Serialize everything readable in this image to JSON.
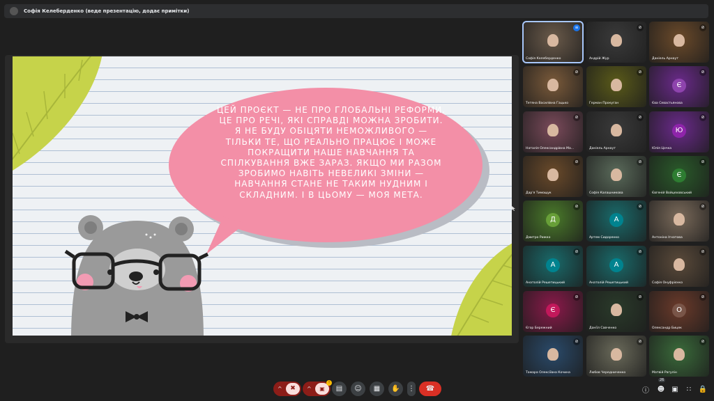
{
  "topbar": {
    "title": "Софія Келеберденко (веде презентацію, додає примітки)"
  },
  "slide": {
    "text": "Цей проєкт — не про глобальні реформи. Це про речі, які справді можна зробити. Я не буду обіцяти неможливого — тільки те, що реально працює і може покращити наше навчання та спілкування вже зараз. Якщо ми разом зробимо навіть невеликі зміни — навчання стане не таким нудним і складним. І в цьому — моя мета.",
    "colors": {
      "bubble": "#f38fa7",
      "leaf": "#c6d34a",
      "bear": "#9a9a9a"
    }
  },
  "participants": [
    {
      "name": "Софія Келеберденко",
      "type": "video",
      "bg": "#6a5a4a",
      "mic_icon": "speaking-icon",
      "active": true
    },
    {
      "name": "Андрій Жур",
      "type": "video",
      "bg": "#3a3a3a",
      "mic_icon": "mic-off-icon"
    },
    {
      "name": "Даніель Арнаут",
      "type": "video",
      "bg": "#6b4a2a",
      "mic_icon": "mic-off-icon"
    },
    {
      "name": "Тетяна Василівна Гацько",
      "type": "video",
      "bg": "#7a5a3a",
      "mic_icon": "mic-off-icon"
    },
    {
      "name": "Герман Прокуган",
      "type": "video",
      "bg": "#5a5a1a",
      "mic_icon": "mic-off-icon"
    },
    {
      "name": "Єва Севастьянова",
      "type": "letter",
      "letter": "Є",
      "bg": "#6a2a8a",
      "circle": "#8e44ad",
      "mic_icon": "mic-off-icon"
    },
    {
      "name": "Наталія Олександрівна Ма...",
      "type": "video",
      "bg": "#7a4a5a",
      "mic_icon": "mic-off-icon"
    },
    {
      "name": "Даніель Арнаут",
      "type": "video",
      "bg": "#3a3a3a",
      "mic_icon": "mic-off-icon"
    },
    {
      "name": "Юлія Цочка",
      "type": "letter",
      "letter": "Ю",
      "bg": "#6a2a8a",
      "circle": "#8e24aa",
      "mic_icon": "mic-off-icon"
    },
    {
      "name": "Дар'я Тимощук",
      "type": "video",
      "bg": "#6a4a2a",
      "mic_icon": "mic-off-icon"
    },
    {
      "name": "Софія Калашникова",
      "type": "video",
      "bg": "#5a6a5a",
      "mic_icon": "mic-off-icon"
    },
    {
      "name": "Євгеній Войцеховський",
      "type": "letter",
      "letter": "Є",
      "bg": "#2a5a2a",
      "circle": "#2e7d32",
      "mic_icon": "mic-off-icon"
    },
    {
      "name": "Дмитро Рижко",
      "type": "letter",
      "letter": "Д",
      "bg": "#4a7a2a",
      "circle": "#689f38",
      "mic_icon": "mic-off-icon"
    },
    {
      "name": "Артем Сидоренко",
      "type": "letter",
      "letter": "А",
      "bg": "#1a6a6a",
      "circle": "#00838f",
      "mic_icon": "mic-off-icon"
    },
    {
      "name": "Антоніна Ігнатова",
      "type": "video",
      "bg": "#7a6a5a",
      "mic_icon": "mic-off-icon"
    },
    {
      "name": "Анатолій Решетицький",
      "type": "letter",
      "letter": "А",
      "bg": "#1a6a6a",
      "circle": "#00838f",
      "mic_icon": "mic-off-icon"
    },
    {
      "name": "Анатолій Решетицький",
      "type": "letter",
      "letter": "А",
      "bg": "#1a6a6a",
      "circle": "#00838f",
      "mic_icon": "mic-off-icon"
    },
    {
      "name": "Софія Онуфрієнко",
      "type": "video",
      "bg": "#5a4a3a",
      "mic_icon": "mic-off-icon"
    },
    {
      "name": "Єгор Бережний",
      "type": "letter",
      "letter": "Є",
      "bg": "#8a1a4a",
      "circle": "#c2185b",
      "mic_icon": "mic-off-icon"
    },
    {
      "name": "Даніїл Савченко",
      "type": "video",
      "bg": "#2a3a2a",
      "mic_icon": "mic-off-icon"
    },
    {
      "name": "Олександр Бицек",
      "type": "letter",
      "letter": "О",
      "bg": "#6a3a2a",
      "circle": "#795548",
      "mic_icon": "mic-off-icon"
    },
    {
      "name": "Тамара Олексіївна Кочина",
      "type": "video",
      "bg": "#2a4a6a",
      "mic_icon": "mic-off-icon"
    },
    {
      "name": "Любов Чередниченко",
      "type": "video",
      "bg": "#6a6a5a",
      "mic_icon": "mic-off-icon"
    },
    {
      "name": "Матвій Рагулін",
      "type": "video",
      "bg": "#3a6a3a",
      "mic_icon": "mic-off-icon"
    }
  ],
  "toolbar": {
    "mic_caret": "^",
    "mic_icon": "mic-off-icon",
    "camera_caret": "^",
    "camera_icon": "camera-off-icon",
    "camera_badge": "!",
    "present_icon": "present-icon",
    "emoji_icon": "emoji-icon",
    "captions_icon": "captions-icon",
    "raise_hand_icon": "raise-hand-icon",
    "more_icon": "more-vert-icon",
    "end_call_icon": "end-call-icon",
    "info_icon": "info-icon",
    "people_icon": "people-icon",
    "people_count": "26",
    "chat_icon": "chat-icon",
    "activities_icon": "apps-icon",
    "lock_icon": "host-controls-icon"
  }
}
